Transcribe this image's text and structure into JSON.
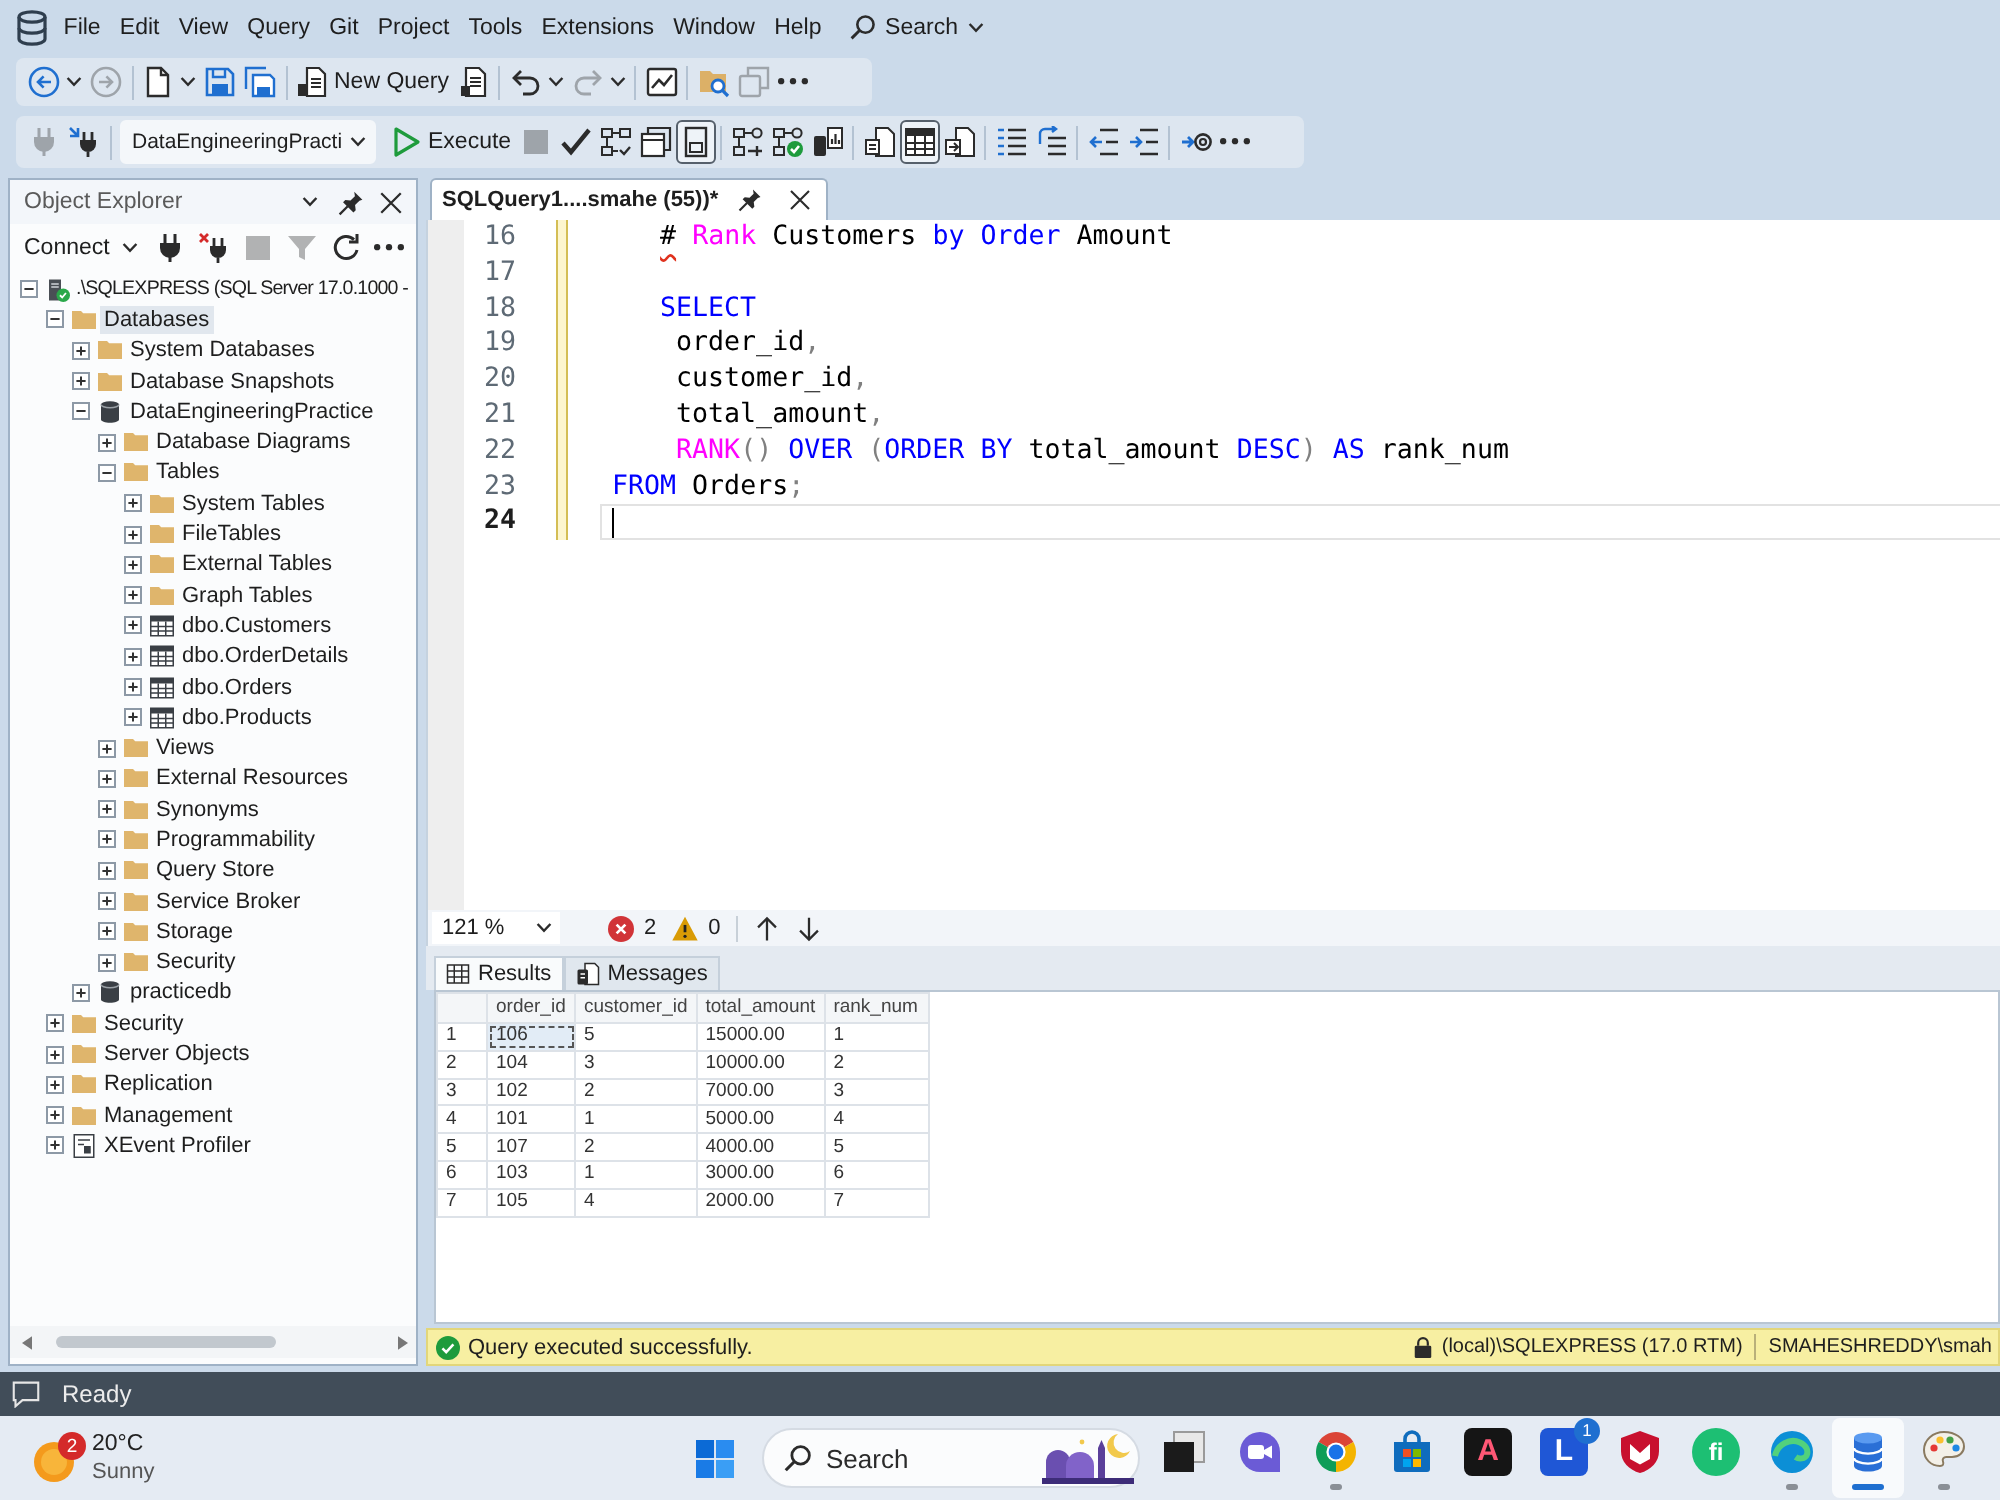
{
  "menu_bar": {
    "items": [
      "File",
      "Edit",
      "View",
      "Query",
      "Git",
      "Project",
      "Tools",
      "Extensions",
      "Window",
      "Help"
    ],
    "search": "Search"
  },
  "standard_toolbar": {
    "groups": [
      [
        {
          "kind": "back",
          "disabled": false,
          "menu": true
        },
        {
          "kind": "forward",
          "disabled": true
        }
      ],
      [
        {
          "kind": "newfile",
          "disabled": false,
          "menu": true
        },
        {
          "kind": "save",
          "disabled": false
        },
        {
          "kind": "saveall",
          "disabled": false
        }
      ],
      [
        {
          "kind": "newquery",
          "label": "New Query",
          "disabled": false
        },
        {
          "kind": "queryfile",
          "disabled": false
        }
      ],
      [
        {
          "kind": "undo",
          "disabled": false,
          "menu": true
        },
        {
          "kind": "redo",
          "disabled": true,
          "menu": true
        }
      ],
      [
        {
          "kind": "monitor",
          "disabled": false
        }
      ],
      [
        {
          "kind": "foldersearch",
          "disabled": false
        },
        {
          "kind": "windows",
          "disabled": true
        },
        {
          "kind": "more",
          "disabled": false
        }
      ]
    ]
  },
  "sql_toolbar": {
    "groups": [
      [
        {
          "kind": "plug",
          "disabled": true,
          "pressed": false
        },
        {
          "kind": "changeconn",
          "disabled": false,
          "pressed": false
        }
      ],
      [
        {
          "kind": "combo",
          "value": "DataEngineeringPracti",
          "disabled": false,
          "pressed": false
        },
        {
          "kind": "execute",
          "label": "Execute",
          "disabled": false,
          "pressed": false
        },
        {
          "kind": "stop",
          "disabled": true,
          "pressed": false
        },
        {
          "kind": "check",
          "disabled": false,
          "pressed": false
        },
        {
          "kind": "estplan",
          "disabled": false,
          "pressed": false
        },
        {
          "kind": "options",
          "disabled": false,
          "pressed": false
        },
        {
          "kind": "intellisense",
          "disabled": false,
          "pressed": true
        }
      ],
      [
        {
          "kind": "liveplan",
          "disabled": false,
          "pressed": false
        },
        {
          "kind": "actualplan",
          "disabled": false,
          "pressed": false
        },
        {
          "kind": "stats",
          "disabled": false,
          "pressed": false
        }
      ],
      [
        {
          "kind": "totext",
          "disabled": false,
          "pressed": false
        },
        {
          "kind": "togrid",
          "disabled": false,
          "pressed": true
        },
        {
          "kind": "tofile",
          "disabled": false,
          "pressed": false
        }
      ],
      [
        {
          "kind": "comment",
          "disabled": false,
          "pressed": false
        },
        {
          "kind": "uncomment",
          "disabled": false,
          "pressed": false
        }
      ],
      [
        {
          "kind": "outdent",
          "disabled": false,
          "pressed": false
        },
        {
          "kind": "indent",
          "disabled": false,
          "pressed": false
        }
      ],
      [
        {
          "kind": "params",
          "disabled": false,
          "pressed": false
        },
        {
          "kind": "more",
          "disabled": false,
          "pressed": false
        }
      ]
    ]
  },
  "object_explorer": {
    "title": "Object Explorer",
    "connect": "Connect",
    "tools": [
      {
        "kind": "plug",
        "disabled": false
      },
      {
        "kind": "disconnect",
        "disabled": false
      },
      {
        "kind": "stop",
        "disabled": true
      },
      {
        "kind": "filter",
        "disabled": true
      },
      {
        "kind": "refresh",
        "disabled": false
      },
      {
        "kind": "more",
        "disabled": false
      }
    ],
    "tree": [
      {
        "label": ".\\SQLEXPRESS (SQL Server 17.0.1000 -",
        "kind": "server",
        "expanded": true,
        "selected": false,
        "children": [
          {
            "label": "Databases",
            "kind": "folder",
            "expanded": true,
            "selected": true,
            "children": [
              {
                "label": "System Databases",
                "kind": "folder",
                "expanded": false,
                "selected": false
              },
              {
                "label": "Database Snapshots",
                "kind": "folder",
                "expanded": false,
                "selected": false
              },
              {
                "label": "DataEngineeringPractice",
                "kind": "database",
                "expanded": true,
                "selected": false,
                "children": [
                  {
                    "label": "Database Diagrams",
                    "kind": "folder",
                    "expanded": false,
                    "selected": false
                  },
                  {
                    "label": "Tables",
                    "kind": "folder",
                    "expanded": true,
                    "selected": false,
                    "children": [
                      {
                        "label": "System Tables",
                        "kind": "folder",
                        "expanded": false,
                        "selected": false
                      },
                      {
                        "label": "FileTables",
                        "kind": "folder",
                        "expanded": false,
                        "selected": false
                      },
                      {
                        "label": "External Tables",
                        "kind": "folder",
                        "expanded": false,
                        "selected": false
                      },
                      {
                        "label": "Graph Tables",
                        "kind": "folder",
                        "expanded": false,
                        "selected": false
                      },
                      {
                        "label": "dbo.Customers",
                        "kind": "table",
                        "expanded": false,
                        "selected": false
                      },
                      {
                        "label": "dbo.OrderDetails",
                        "kind": "table",
                        "expanded": false,
                        "selected": false
                      },
                      {
                        "label": "dbo.Orders",
                        "kind": "table",
                        "expanded": false,
                        "selected": false
                      },
                      {
                        "label": "dbo.Products",
                        "kind": "table",
                        "expanded": false,
                        "selected": false
                      }
                    ]
                  },
                  {
                    "label": "Views",
                    "kind": "folder",
                    "expanded": false,
                    "selected": false
                  },
                  {
                    "label": "External Resources",
                    "kind": "folder",
                    "expanded": false,
                    "selected": false
                  },
                  {
                    "label": "Synonyms",
                    "kind": "folder",
                    "expanded": false,
                    "selected": false
                  },
                  {
                    "label": "Programmability",
                    "kind": "folder",
                    "expanded": false,
                    "selected": false
                  },
                  {
                    "label": "Query Store",
                    "kind": "folder",
                    "expanded": false,
                    "selected": false
                  },
                  {
                    "label": "Service Broker",
                    "kind": "folder",
                    "expanded": false,
                    "selected": false
                  },
                  {
                    "label": "Storage",
                    "kind": "folder",
                    "expanded": false,
                    "selected": false
                  },
                  {
                    "label": "Security",
                    "kind": "folder",
                    "expanded": false,
                    "selected": false
                  }
                ]
              },
              {
                "label": "practicedb",
                "kind": "database",
                "expanded": false,
                "selected": false
              }
            ]
          },
          {
            "label": "Security",
            "kind": "folder",
            "expanded": false,
            "selected": false
          },
          {
            "label": "Server Objects",
            "kind": "folder",
            "expanded": false,
            "selected": false
          },
          {
            "label": "Replication",
            "kind": "folder",
            "expanded": false,
            "selected": false
          },
          {
            "label": "Management",
            "kind": "folder",
            "expanded": false,
            "selected": false
          },
          {
            "label": "XEvent Profiler",
            "kind": "profiler",
            "expanded": false,
            "selected": false
          }
        ]
      }
    ]
  },
  "editor": {
    "tab": {
      "title": "SQLQuery1....smahe (55))*",
      "selected": true
    },
    "lines": [
      {
        "number": "16",
        "changed": true,
        "current": false,
        "tokens": [
          {
            "text": "   #",
            "kind": "error"
          },
          {
            "text": " Rank",
            "kind": "function"
          },
          {
            "text": " Customers",
            "kind": "plain"
          },
          {
            "text": " by",
            "kind": "keyword"
          },
          {
            "text": " Order",
            "kind": "keyword"
          },
          {
            "text": " Amount",
            "kind": "plain"
          }
        ]
      },
      {
        "number": "17",
        "changed": true,
        "current": false
      },
      {
        "number": "18",
        "changed": true,
        "current": false,
        "tokens": [
          {
            "text": "   SELECT",
            "kind": "keyword"
          }
        ]
      },
      {
        "number": "19",
        "changed": true,
        "current": false,
        "tokens": [
          {
            "text": "    order_id",
            "kind": "plain"
          },
          {
            "text": ",",
            "kind": "punct"
          }
        ]
      },
      {
        "number": "20",
        "changed": true,
        "current": false,
        "tokens": [
          {
            "text": "    customer_id",
            "kind": "plain"
          },
          {
            "text": ",",
            "kind": "punct"
          }
        ]
      },
      {
        "number": "21",
        "changed": true,
        "current": false,
        "tokens": [
          {
            "text": "    total_amount",
            "kind": "plain"
          },
          {
            "text": ",",
            "kind": "punct"
          }
        ]
      },
      {
        "number": "22",
        "changed": true,
        "current": false,
        "tokens": [
          {
            "text": "    RANK",
            "kind": "function"
          },
          {
            "text": "()",
            "kind": "punct"
          },
          {
            "text": " OVER",
            "kind": "keyword"
          },
          {
            "text": " (",
            "kind": "punct"
          },
          {
            "text": "ORDER BY",
            "kind": "keyword"
          },
          {
            "text": " total_amount",
            "kind": "plain"
          },
          {
            "text": " DESC",
            "kind": "keyword"
          },
          {
            "text": ")",
            "kind": "punct"
          },
          {
            "text": " AS",
            "kind": "keyword"
          },
          {
            "text": " rank_num",
            "kind": "plain"
          }
        ]
      },
      {
        "number": "23",
        "changed": true,
        "current": false,
        "tokens": [
          {
            "text": "FROM",
            "kind": "keyword"
          },
          {
            "text": " Orders",
            "kind": "plain"
          },
          {
            "text": ";",
            "kind": "punct"
          }
        ]
      },
      {
        "number": "24",
        "changed": true,
        "current": true
      }
    ]
  },
  "results_bar": {
    "zoom": "121 %",
    "errors": "2",
    "warnings": "0"
  },
  "results": {
    "tabs": [
      {
        "label": "Results",
        "kind": "grid",
        "selected": true
      },
      {
        "label": "Messages",
        "kind": "messages",
        "selected": false
      }
    ],
    "columns": [
      "order_id",
      "customer_id",
      "total_amount",
      "rank_num"
    ],
    "rows": [
      {
        "number": "1",
        "cells": [
          {
            "text": "106",
            "selected": true
          },
          {
            "text": "5",
            "selected": false
          },
          {
            "text": "15000.00",
            "selected": false
          },
          {
            "text": "1",
            "selected": false
          }
        ]
      },
      {
        "number": "2",
        "cells": [
          {
            "text": "104",
            "selected": false
          },
          {
            "text": "3",
            "selected": false
          },
          {
            "text": "10000.00",
            "selected": false
          },
          {
            "text": "2",
            "selected": false
          }
        ]
      },
      {
        "number": "3",
        "cells": [
          {
            "text": "102",
            "selected": false
          },
          {
            "text": "2",
            "selected": false
          },
          {
            "text": "7000.00",
            "selected": false
          },
          {
            "text": "3",
            "selected": false
          }
        ]
      },
      {
        "number": "4",
        "cells": [
          {
            "text": "101",
            "selected": false
          },
          {
            "text": "1",
            "selected": false
          },
          {
            "text": "5000.00",
            "selected": false
          },
          {
            "text": "4",
            "selected": false
          }
        ]
      },
      {
        "number": "5",
        "cells": [
          {
            "text": "107",
            "selected": false
          },
          {
            "text": "2",
            "selected": false
          },
          {
            "text": "4000.00",
            "selected": false
          },
          {
            "text": "5",
            "selected": false
          }
        ]
      },
      {
        "number": "6",
        "cells": [
          {
            "text": "103",
            "selected": false
          },
          {
            "text": "1",
            "selected": false
          },
          {
            "text": "3000.00",
            "selected": false
          },
          {
            "text": "6",
            "selected": false
          }
        ]
      },
      {
        "number": "7",
        "cells": [
          {
            "text": "105",
            "selected": false
          },
          {
            "text": "4",
            "selected": false
          },
          {
            "text": "2000.00",
            "selected": false
          },
          {
            "text": "7",
            "selected": false
          }
        ]
      }
    ]
  },
  "status_bar": {
    "message": "Query executed successfully.",
    "server": "(local)\\SQLEXPRESS (17.0 RTM)",
    "user": "SMAHESHREDDY\\smah"
  },
  "app_status": {
    "text": "Ready"
  },
  "taskbar": {
    "weather": {
      "badge": "2",
      "temperature": "20°C",
      "condition": "Sunny"
    },
    "search": {
      "placeholder": "Search"
    },
    "apps": [
      {
        "kind": "stack",
        "running": false,
        "selected": false
      },
      {
        "kind": "video",
        "running": false,
        "selected": false
      },
      {
        "kind": "chrome",
        "running": true,
        "selected": false
      },
      {
        "kind": "store",
        "running": false,
        "selected": false
      },
      {
        "kind": "darktile",
        "label": "A",
        "running": false,
        "selected": false
      },
      {
        "kind": "bluetile",
        "label": "L",
        "badge": "1",
        "running": false,
        "selected": false
      },
      {
        "kind": "shield",
        "running": false,
        "selected": false
      },
      {
        "kind": "greencircle",
        "label": "fi",
        "running": false,
        "selected": false
      },
      {
        "kind": "edge",
        "running": true,
        "selected": false
      },
      {
        "kind": "ssms",
        "running": true,
        "selected": true
      },
      {
        "kind": "paint",
        "running": true,
        "selected": false
      }
    ]
  }
}
